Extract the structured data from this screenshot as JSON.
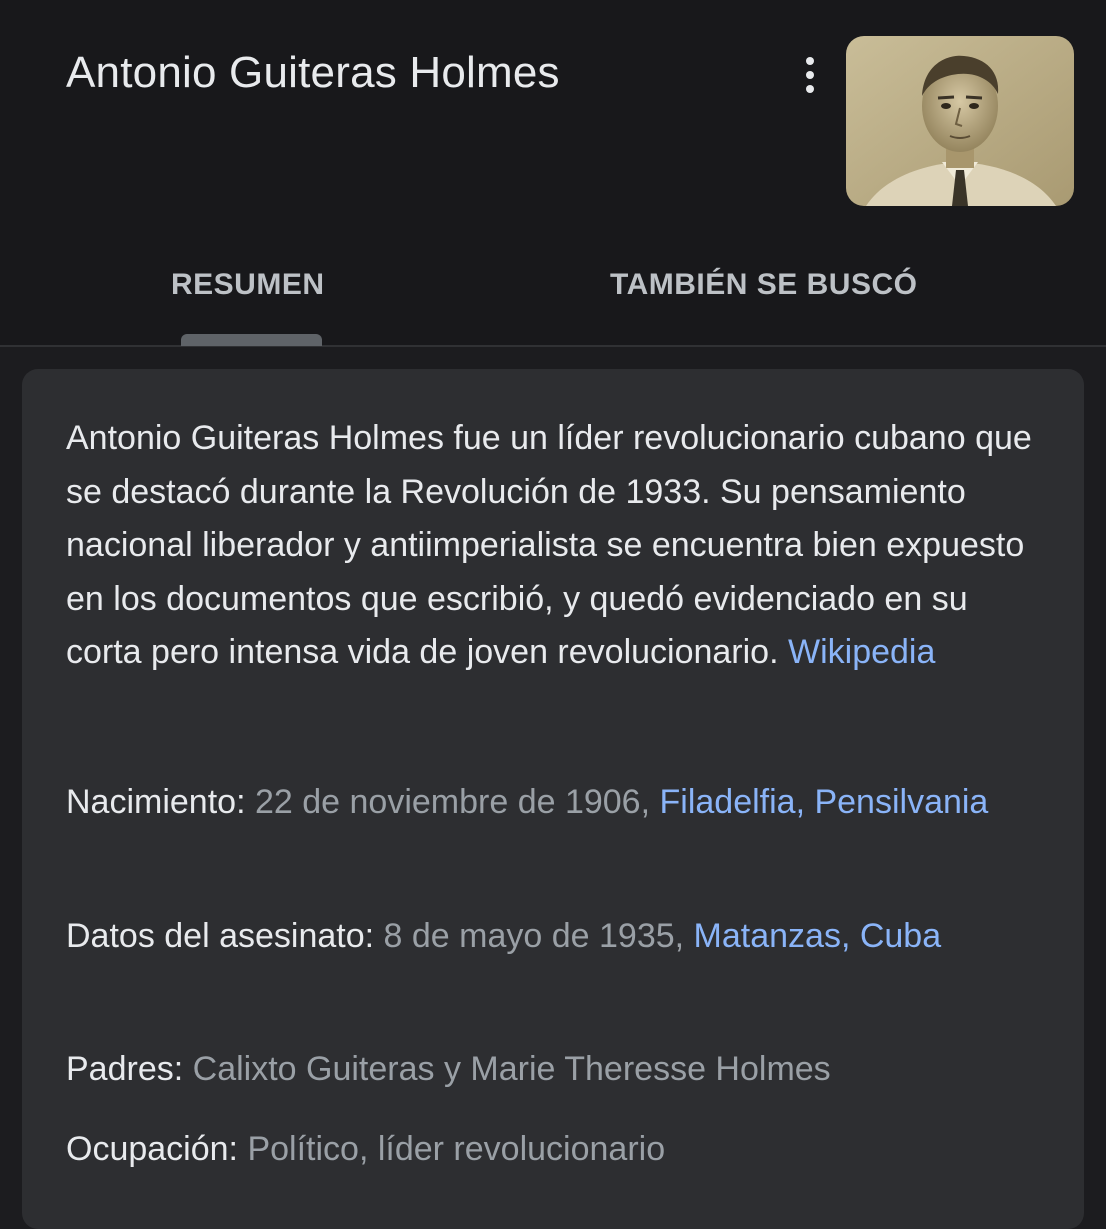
{
  "header": {
    "title": "Antonio Guiteras Holmes",
    "menu_icon": "more-vertical-icon",
    "photo_alt": "Antonio Guiteras Holmes"
  },
  "tabs": [
    {
      "label": "RESUMEN",
      "selected": true
    },
    {
      "label": "TAMBIÉN SE BUSCÓ",
      "selected": false
    }
  ],
  "summary": {
    "description": "Antonio Guiteras Holmes fue un líder revolucionario cubano que se destacó durante la Revolución de 1933. Su pensamiento nacional liberador y antiimperialista se encuentra bien expuesto en los documentos que escribió, y quedó evidenciado en su corta pero intensa vida de joven revolucionario.",
    "source_link": "Wikipedia"
  },
  "facts": {
    "nacimiento": {
      "label": "Nacimiento:",
      "value": "22 de noviembre de 1906,",
      "link": "Filadelfia, Pensilvania"
    },
    "asesinato": {
      "label": "Datos del asesinato:",
      "value": "8 de mayo de 1935,",
      "link": "Matanzas, Cuba"
    },
    "padres": {
      "label": "Padres:",
      "value": "Calixto Guiteras y Marie Theresse Holmes"
    },
    "ocupacion": {
      "label": "Ocupación:",
      "value": "Político, líder revolucionario"
    }
  },
  "colors": {
    "background": "#1c1c1f",
    "card": "#2d2e31",
    "text": "#e8eaed",
    "muted": "#9aa0a6",
    "link": "#8ab4f8"
  }
}
